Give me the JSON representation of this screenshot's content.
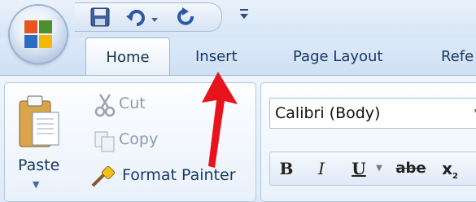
{
  "quick_access": {
    "save_icon": "save-icon",
    "undo_icon": "undo-icon",
    "redo_icon": "redo-icon",
    "customize_icon": "customize-qat-icon"
  },
  "tabs": [
    {
      "label": "Home",
      "active": true
    },
    {
      "label": "Insert",
      "active": false
    },
    {
      "label": "Page Layout",
      "active": false
    },
    {
      "label": "Refe",
      "active": false
    }
  ],
  "clipboard": {
    "paste_label": "Paste",
    "cut_label": "Cut",
    "copy_label": "Copy",
    "format_painter_label": "Format Painter"
  },
  "font": {
    "font_name": "Calibri (Body)",
    "bold": "B",
    "italic": "I",
    "underline": "U",
    "strikethrough": "abe",
    "subscript": "x"
  },
  "annotation": {
    "arrow_color": "#e8141c",
    "points_to": "Insert"
  },
  "colors": {
    "ribbon_bg": "#dfeaf8",
    "tab_text": "#1a3760"
  }
}
